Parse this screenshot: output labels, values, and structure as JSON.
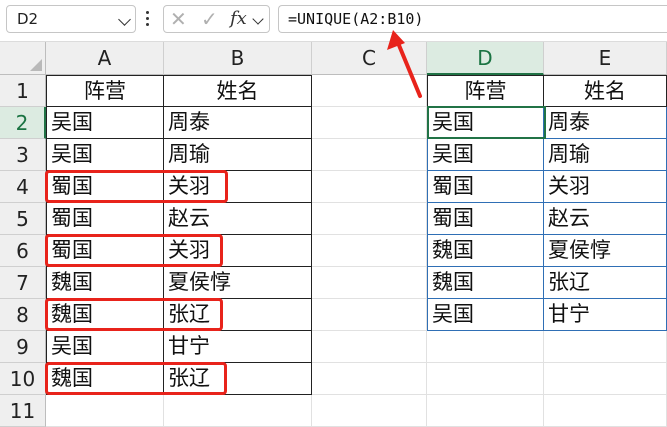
{
  "name_box": {
    "value": "D2"
  },
  "formula_bar": {
    "cancel_glyph": "✕",
    "enter_glyph": "✓",
    "fx_label": "fx",
    "formula": "=UNIQUE(A2:B10)"
  },
  "columns": [
    "A",
    "B",
    "C",
    "D",
    "E"
  ],
  "rows": [
    "1",
    "2",
    "3",
    "4",
    "5",
    "6",
    "7",
    "8",
    "9",
    "10",
    "11"
  ],
  "source_table": {
    "headers": [
      "阵营",
      "姓名"
    ],
    "rows": [
      [
        "吴国",
        "周泰"
      ],
      [
        "吴国",
        "周瑜"
      ],
      [
        "蜀国",
        "关羽"
      ],
      [
        "蜀国",
        "赵云"
      ],
      [
        "蜀国",
        "关羽"
      ],
      [
        "魏国",
        "夏侯惇"
      ],
      [
        "魏国",
        "张辽"
      ],
      [
        "吴国",
        "甘宁"
      ],
      [
        "魏国",
        "张辽"
      ]
    ]
  },
  "result_table": {
    "headers": [
      "阵营",
      "姓名"
    ],
    "rows": [
      [
        "吴国",
        "周泰"
      ],
      [
        "吴国",
        "周瑜"
      ],
      [
        "蜀国",
        "关羽"
      ],
      [
        "蜀国",
        "赵云"
      ],
      [
        "魏国",
        "夏侯惇"
      ],
      [
        "魏国",
        "张辽"
      ],
      [
        "吴国",
        "甘宁"
      ]
    ]
  },
  "selection": {
    "active_column": "D",
    "active_row": "2"
  },
  "duplicate_rows": [
    "4",
    "6",
    "8",
    "10"
  ],
  "colors": {
    "selection_green": "#217346",
    "highlight_red": "#e8231b",
    "spill_blue": "#2f6fb5"
  }
}
